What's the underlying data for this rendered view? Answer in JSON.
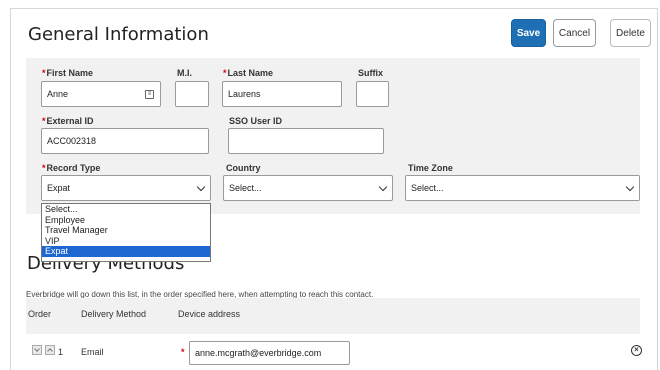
{
  "header": {
    "title": "General Information",
    "save_label": "Save",
    "cancel_label": "Cancel",
    "delete_label": "Delete"
  },
  "form": {
    "first_name": {
      "label": "First Name",
      "value": "Anne"
    },
    "mi": {
      "label": "M.I.",
      "value": ""
    },
    "last_name": {
      "label": "Last Name",
      "value": "Laurens"
    },
    "suffix": {
      "label": "Suffix",
      "value": ""
    },
    "external_id": {
      "label": "External ID",
      "value": "ACC002318"
    },
    "sso_user_id": {
      "label": "SSO User ID",
      "value": ""
    },
    "record_type": {
      "label": "Record Type",
      "value": "Expat",
      "options": [
        "Select...",
        "Employee",
        "Travel Manager",
        "VIP",
        "Expat"
      ]
    },
    "country": {
      "label": "Country",
      "value": "Select..."
    },
    "time_zone": {
      "label": "Time Zone",
      "value": "Select..."
    },
    "required_marker": "*"
  },
  "delivery": {
    "title": "Delivery Methods",
    "description": "Everbridge will go down this list, in the order specified here, when attempting to reach this contact.",
    "columns": {
      "order": "Order",
      "method": "Delivery Method",
      "address": "Device address"
    },
    "rows": [
      {
        "order": "1",
        "method": "Email",
        "address": "anne.mcgrath@everbridge.com"
      }
    ]
  },
  "icons": {
    "contact_card": "contact-card-icon",
    "remove": "remove-icon",
    "chevron": "chevron-down-icon"
  },
  "colors": {
    "primary": "#1f6fb5",
    "required": "#d0021b",
    "selected_option": "#1e66d0"
  }
}
